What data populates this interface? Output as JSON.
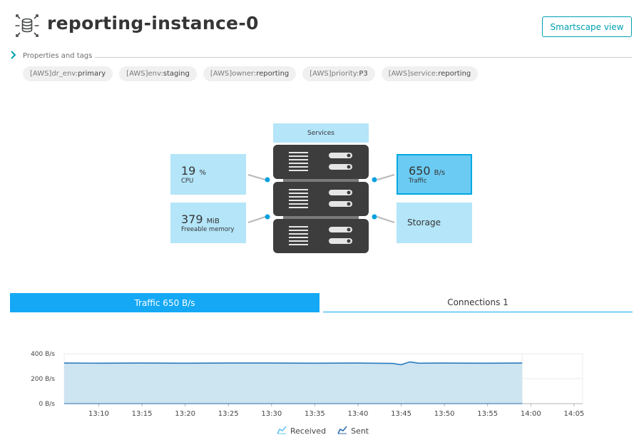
{
  "header": {
    "title": "reporting-instance-0",
    "smartscape_label": "Smartscape view",
    "icon": "database-instance-icon"
  },
  "properties": {
    "label": "Properties and tags",
    "expand_icon": "chevron-right-icon"
  },
  "tags": [
    {
      "key": "[AWS]dr_env: ",
      "value": "primary"
    },
    {
      "key": "[AWS]env: ",
      "value": "staging"
    },
    {
      "key": "[AWS]owner: ",
      "value": "reporting"
    },
    {
      "key": "[AWS]priority: ",
      "value": "P3"
    },
    {
      "key": "[AWS]service: ",
      "value": "reporting"
    }
  ],
  "infographic": {
    "services_label": "Services",
    "cpu": {
      "value": "19",
      "unit": "%",
      "label": "CPU"
    },
    "memory": {
      "value": "379",
      "unit": "MiB",
      "label": "Freeable memory"
    },
    "traffic": {
      "value": "650",
      "unit": "B/s",
      "label": "Traffic"
    },
    "storage": {
      "label": "Storage"
    }
  },
  "tabs": [
    {
      "label": "Traffic 650 B/s",
      "active": true
    },
    {
      "label": "Connections 1",
      "active": false
    }
  ],
  "colors": {
    "accent": "#00a1b2",
    "tab_active": "#14a8f5",
    "tile": "#b4e5f9",
    "tile_selected": "#6bcbf3",
    "server": "#3d3d3d"
  },
  "chart_data": {
    "type": "area",
    "ylabel_ticks": [
      "400 B/s",
      "200 B/s",
      "0 B/s"
    ],
    "yticks": [
      400,
      200,
      0
    ],
    "ylim": [
      0,
      400
    ],
    "x_ticks": [
      "13:10",
      "13:15",
      "13:20",
      "13:25",
      "13:30",
      "13:35",
      "13:40",
      "13:45",
      "13:50",
      "13:55",
      "14:00",
      "14:05"
    ],
    "x_range": [
      "13:06",
      "14:06"
    ],
    "x_data_end": "13:59",
    "series": [
      {
        "name": "Received",
        "x": [
          "13:06",
          "13:10",
          "13:15",
          "13:20",
          "13:25",
          "13:30",
          "13:35",
          "13:40",
          "13:44",
          "13:45",
          "13:46",
          "13:47",
          "13:50",
          "13:55",
          "13:59"
        ],
        "values": [
          325,
          324,
          325,
          324,
          325,
          325,
          324,
          325,
          322,
          312,
          335,
          324,
          325,
          324,
          325
        ]
      },
      {
        "name": "Sent",
        "x": [
          "13:06",
          "13:10",
          "13:15",
          "13:20",
          "13:25",
          "13:30",
          "13:35",
          "13:40",
          "13:45",
          "13:50",
          "13:55",
          "13:59"
        ],
        "values": [
          0,
          0,
          0,
          0,
          0,
          0,
          0,
          0,
          0,
          0,
          0,
          0
        ]
      }
    ],
    "grid": true,
    "legend": "bottom-center"
  }
}
